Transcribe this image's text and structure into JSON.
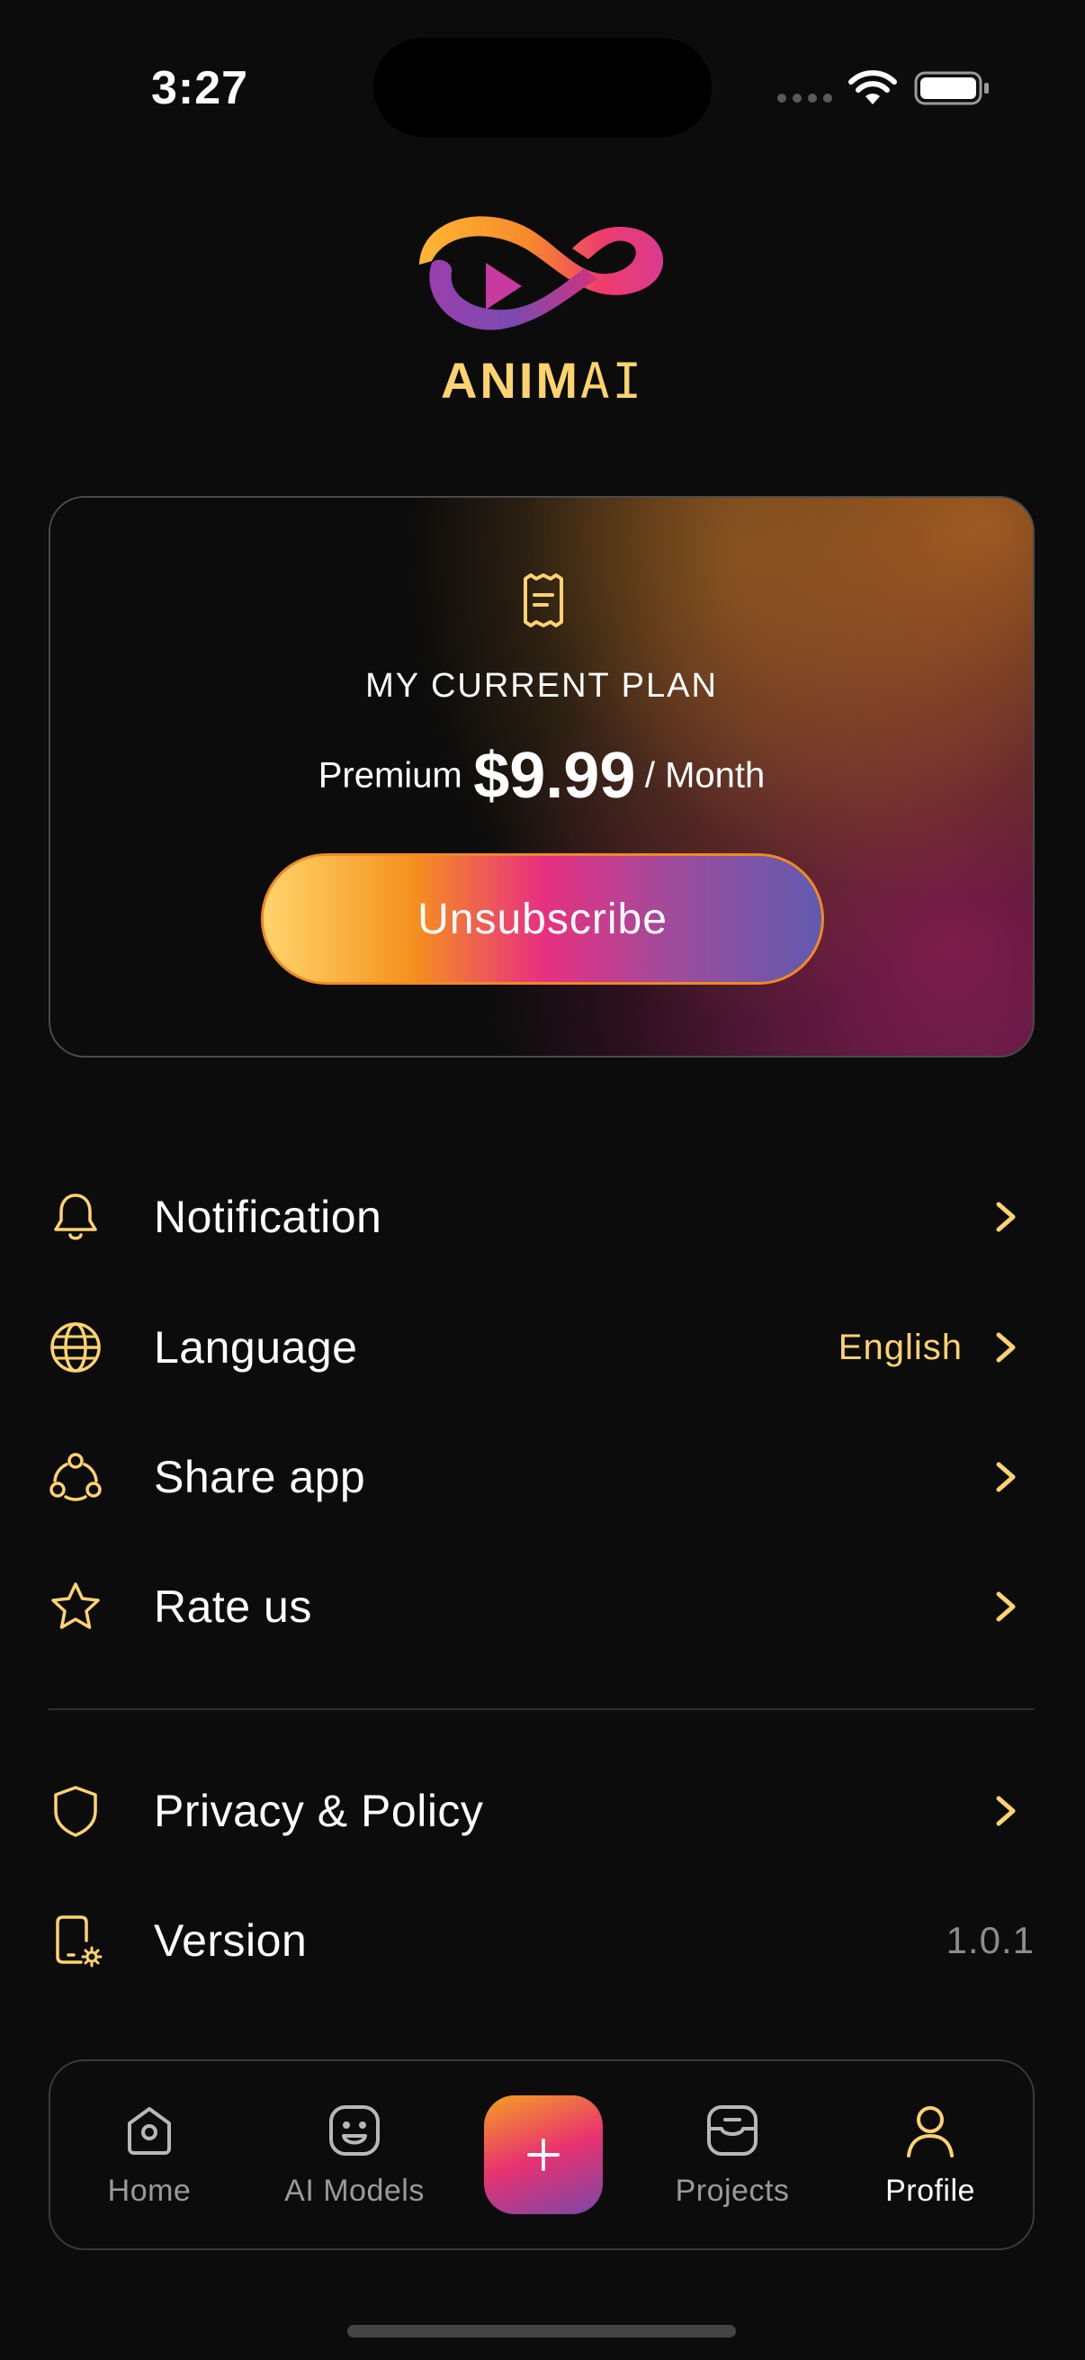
{
  "status_bar": {
    "time": "3:27"
  },
  "brand": {
    "logo_text_bold": "ANIM",
    "logo_text_light": "AI",
    "accent_color": "#ffd36e"
  },
  "plan_card": {
    "heading": "MY CURRENT PLAN",
    "plan_name": "Premium",
    "price": "$9.99",
    "period": "/ Month",
    "button_label": "Unsubscribe",
    "icon": "receipt-icon"
  },
  "settings": {
    "items": [
      {
        "key": "notification",
        "icon": "bell-icon",
        "label": "Notification",
        "value": "",
        "has_chevron": true
      },
      {
        "key": "language",
        "icon": "globe-icon",
        "label": "Language",
        "value": "English",
        "has_chevron": true
      },
      {
        "key": "share",
        "icon": "share-icon",
        "label": "Share app",
        "value": "",
        "has_chevron": true
      },
      {
        "key": "rate",
        "icon": "star-icon",
        "label": "Rate us",
        "value": "",
        "has_chevron": true
      },
      {
        "key": "privacy",
        "icon": "shield-icon",
        "label": "Privacy & Policy",
        "value": "",
        "has_chevron": true
      },
      {
        "key": "version",
        "icon": "phone-settings-icon",
        "label": "Version",
        "value": "1.0.1",
        "has_chevron": false
      }
    ]
  },
  "bottom_nav": {
    "items": [
      {
        "key": "home",
        "icon": "home-icon",
        "label": "Home",
        "active": false
      },
      {
        "key": "ai-models",
        "icon": "robot-face-icon",
        "label": "AI Models",
        "active": false
      },
      {
        "key": "projects",
        "icon": "inbox-icon",
        "label": "Projects",
        "active": false
      },
      {
        "key": "profile",
        "icon": "user-icon",
        "label": "Profile",
        "active": true
      }
    ],
    "create_icon": "plus-icon"
  }
}
